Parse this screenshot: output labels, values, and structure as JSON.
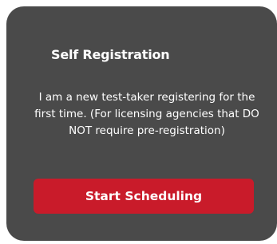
{
  "card": {
    "title": "Self Registration",
    "description": "I am a new test-taker registering for the first time. (For licensing agencies that DO NOT require pre-registration)",
    "cta_label": "Start Scheduling"
  },
  "colors": {
    "card_background": "#4a4a4a",
    "accent_button": "#c91b2a",
    "text": "#ffffff"
  }
}
